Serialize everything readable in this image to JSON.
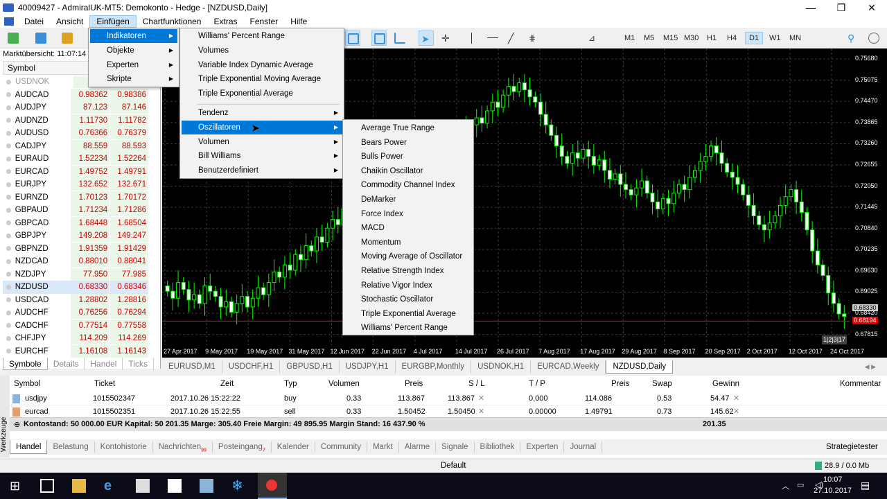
{
  "window": {
    "title": "40009427 - AdmiralUK-MT5: Demokonto - Hedge - [NZDUSD,Daily]",
    "minimize": "—",
    "restore": "❐",
    "close": "✕"
  },
  "menubar": [
    "Datei",
    "Ansicht",
    "Einfügen",
    "Chartfunktionen",
    "Extras",
    "Fenster",
    "Hilfe"
  ],
  "timeframes": [
    "M1",
    "M5",
    "M15",
    "M30",
    "H1",
    "H4",
    "D1",
    "W1",
    "MN"
  ],
  "market_watch": {
    "title": "Marktübersicht: 11:07:14",
    "header": "Symbol",
    "partial_first": {
      "symbol": "USDNOK",
      "bid": "8."
    },
    "rows": [
      {
        "symbol": "AUDCAD",
        "bid": "0.98362",
        "ask": "0.98386"
      },
      {
        "symbol": "AUDJPY",
        "bid": "87.123",
        "ask": "87.146"
      },
      {
        "symbol": "AUDNZD",
        "bid": "1.11730",
        "ask": "1.11782"
      },
      {
        "symbol": "AUDUSD",
        "bid": "0.76366",
        "ask": "0.76379"
      },
      {
        "symbol": "CADJPY",
        "bid": "88.559",
        "ask": "88.593"
      },
      {
        "symbol": "EURAUD",
        "bid": "1.52234",
        "ask": "1.52264"
      },
      {
        "symbol": "EURCAD",
        "bid": "1.49752",
        "ask": "1.49791"
      },
      {
        "symbol": "EURJPY",
        "bid": "132.652",
        "ask": "132.671"
      },
      {
        "symbol": "EURNZD",
        "bid": "1.70123",
        "ask": "1.70172"
      },
      {
        "symbol": "GBPAUD",
        "bid": "1.71234",
        "ask": "1.71286"
      },
      {
        "symbol": "GBPCAD",
        "bid": "1.68448",
        "ask": "1.68504"
      },
      {
        "symbol": "GBPJPY",
        "bid": "149.208",
        "ask": "149.247"
      },
      {
        "symbol": "GBPNZD",
        "bid": "1.91359",
        "ask": "1.91429"
      },
      {
        "symbol": "NZDCAD",
        "bid": "0.88010",
        "ask": "0.88041"
      },
      {
        "symbol": "NZDJPY",
        "bid": "77.950",
        "ask": "77.985"
      },
      {
        "symbol": "NZDUSD",
        "bid": "0.68330",
        "ask": "0.68346"
      },
      {
        "symbol": "USDCAD",
        "bid": "1.28802",
        "ask": "1.28816"
      },
      {
        "symbol": "AUDCHF",
        "bid": "0.76256",
        "ask": "0.76294"
      },
      {
        "symbol": "CADCHF",
        "bid": "0.77514",
        "ask": "0.77558"
      },
      {
        "symbol": "CHFJPY",
        "bid": "114.209",
        "ask": "114.269"
      },
      {
        "symbol": "EURCHF",
        "bid": "1.16108",
        "ask": "1.16143"
      }
    ],
    "selected": "NZDUSD",
    "tabs": [
      "Symbole",
      "Details",
      "Handel",
      "Ticks"
    ]
  },
  "menus": {
    "einfuegen": [
      "Indikatoren",
      "Objekte",
      "Experten",
      "Skripte"
    ],
    "indikatoren_top": [
      "Williams' Percent Range",
      "Volumes",
      "Variable Index Dynamic Average",
      "Triple Exponential Moving Average",
      "Triple Exponential Average"
    ],
    "indikatoren_groups": [
      "Tendenz",
      "Oszillatoren",
      "Volumen",
      "Bill Williams",
      "Benutzerdefiniert"
    ],
    "oszillatoren": [
      "Average True Range",
      "Bears Power",
      "Bulls Power",
      "Chaikin Oscillator",
      "Commodity Channel Index",
      "DeMarker",
      "Force Index",
      "MACD",
      "Momentum",
      "Moving Average of Oscillator",
      "Relative Strength Index",
      "Relative Vigor Index",
      "Stochastic Oscillator",
      "Triple Exponential Average",
      "Williams' Percent Range"
    ]
  },
  "chart_data": {
    "type": "candlestick",
    "symbol": "NZDUSD,Daily",
    "y_ticks": [
      "0.75680",
      "0.75075",
      "0.74470",
      "0.73865",
      "0.73260",
      "0.72655",
      "0.72050",
      "0.71445",
      "0.70840",
      "0.70235",
      "0.69630",
      "0.69025",
      "0.68420",
      "0.67815"
    ],
    "ylim": [
      0.6751,
      0.7598
    ],
    "x_ticks": [
      "27 Apr 2017",
      "9 May 2017",
      "19 May 2017",
      "31 May 2017",
      "12 Jun 2017",
      "22 Jun 2017",
      "4 Jul 2017",
      "14 Jul 2017",
      "26 Jul 2017",
      "7 Aug 2017",
      "17 Aug 2017",
      "29 Aug 2017",
      "8 Sep 2017",
      "20 Sep 2017",
      "2 Oct 2017",
      "12 Oct 2017",
      "24 Oct 2017"
    ],
    "price_line": {
      "label": "0.68194",
      "value": 0.68194
    },
    "bid_label": "0.68330",
    "closes": [
      0.6905,
      0.6885,
      0.693,
      0.691,
      0.688,
      0.6895,
      0.687,
      0.692,
      0.6905,
      0.689,
      0.686,
      0.6875,
      0.6845,
      0.687,
      0.689,
      0.686,
      0.6885,
      0.6915,
      0.6895,
      0.693,
      0.696,
      0.6945,
      0.698,
      0.6965,
      0.701,
      0.6995,
      0.7035,
      0.702,
      0.706,
      0.7045,
      0.7085,
      0.711,
      0.7095,
      0.714,
      0.717,
      0.7155,
      0.7195,
      0.721,
      0.719,
      0.7225,
      0.725,
      0.7235,
      0.727,
      0.729,
      0.7275,
      0.73,
      0.732,
      0.7305,
      0.7285,
      0.731,
      0.733,
      0.7315,
      0.7345,
      0.736,
      0.734,
      0.737,
      0.735,
      0.738,
      0.74,
      0.7385,
      0.742,
      0.7445,
      0.743,
      0.7465,
      0.749,
      0.7475,
      0.75,
      0.748,
      0.746,
      0.7445,
      0.741,
      0.738,
      0.735,
      0.732,
      0.729,
      0.727,
      0.73,
      0.7285,
      0.731,
      0.729,
      0.7265,
      0.728,
      0.725,
      0.7225,
      0.724,
      0.721,
      0.7195,
      0.718,
      0.72,
      0.722,
      0.7185,
      0.716,
      0.714,
      0.717,
      0.7155,
      0.7185,
      0.721,
      0.7195,
      0.723,
      0.725,
      0.7275,
      0.729,
      0.732,
      0.73,
      0.727,
      0.7245,
      0.723,
      0.721,
      0.718,
      0.715,
      0.712,
      0.7095,
      0.708,
      0.71,
      0.712,
      0.715,
      0.7175,
      0.7195,
      0.716,
      0.713,
      0.708,
      0.702,
      0.698,
      0.695,
      0.69,
      0.687,
      0.684,
      0.6833
    ]
  },
  "chart_tabs": [
    "EURUSD,M1",
    "USDCHF,H1",
    "GBPUSD,H1",
    "USDJPY,H1",
    "EURGBP,Monthly",
    "USDNOK,H1",
    "EURCAD,Weekly",
    "NZDUSD,Daily"
  ],
  "chart_badge": "1|2|3|17",
  "terminal": {
    "side_label": "Werkzeuge",
    "headers": [
      "Symbol",
      "Ticket",
      "Zeit",
      "Typ",
      "Volumen",
      "Preis",
      "S / L",
      "T / P",
      "Preis",
      "Swap",
      "Gewinn",
      "Kommentar"
    ],
    "rows": [
      {
        "symbol": "usdjpy",
        "ticket": "1015502347",
        "time": "2017.10.26 15:22:22",
        "type": "buy",
        "volume": "0.33",
        "price": "113.867",
        "sl": "113.867",
        "tp": "0.000",
        "cur": "114.086",
        "swap": "0.53",
        "profit": "54.47"
      },
      {
        "symbol": "eurcad",
        "ticket": "1015502351",
        "time": "2017.10.26 15:22:55",
        "type": "sell",
        "volume": "0.33",
        "price": "1.50452",
        "sl": "1.50450",
        "tp": "0.00000",
        "cur": "1.49791",
        "swap": "0.73",
        "profit": "145.62"
      }
    ],
    "balance": "Kontostand: 50 000.00 EUR  Kapital: 50 201.35  Marge: 305.40  Freie Margin: 49 895.95  Margin Stand: 16 437.90 %",
    "total": "201.35",
    "tabs": [
      {
        "t": "Handel"
      },
      {
        "t": "Belastung"
      },
      {
        "t": "Kontohistorie"
      },
      {
        "t": "Nachrichten",
        "b": "99"
      },
      {
        "t": "Posteingang",
        "b": "7"
      },
      {
        "t": "Kalender"
      },
      {
        "t": "Community"
      },
      {
        "t": "Markt"
      },
      {
        "t": "Alarme"
      },
      {
        "t": "Signale"
      },
      {
        "t": "Bibliothek"
      },
      {
        "t": "Experten"
      },
      {
        "t": "Journal"
      }
    ],
    "strategy": "Strategietester"
  },
  "status": {
    "profile": "Default",
    "traffic": "28.9 / 0.0 Mb"
  },
  "taskbar": {
    "time": "10:07",
    "date": "27.10.2017"
  }
}
